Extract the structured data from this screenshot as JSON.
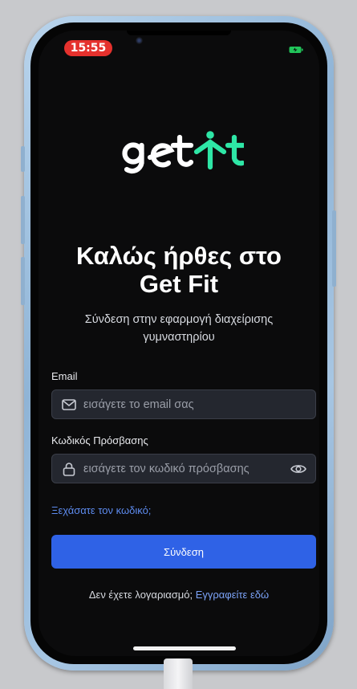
{
  "status_bar": {
    "time": "15:55"
  },
  "brand": {
    "logo_text": "getfit",
    "accent": "#2ee6a6"
  },
  "header": {
    "title_line1": "Καλώς ήρθες στο",
    "title_line2": "Get Fit",
    "subtitle_line1": "Σύνδεση στην εφαρμογή διαχείρισης",
    "subtitle_line2": "γυμναστηρίου"
  },
  "form": {
    "email_label": "Email",
    "email_placeholder": "εισάγετε το email σας",
    "password_label": "Κωδικός Πρόσβασης",
    "password_placeholder": "εισάγετε τον κωδικό πρόσβασης",
    "forgot_link": "Ξεχάσατε τον κωδικό;",
    "submit_label": "Σύνδεση",
    "no_account_text": "Δεν έχετε λογαριασμό;",
    "signup_link": "Εγγραφείτε εδώ"
  },
  "colors": {
    "background": "#0b0b0c",
    "primary_button": "#2f62e6",
    "link": "#5e8cf0",
    "status_time_pill": "#e5312d"
  },
  "icons": [
    "mail-icon",
    "lock-icon",
    "eye-icon",
    "battery-icon",
    "camera-icon"
  ]
}
